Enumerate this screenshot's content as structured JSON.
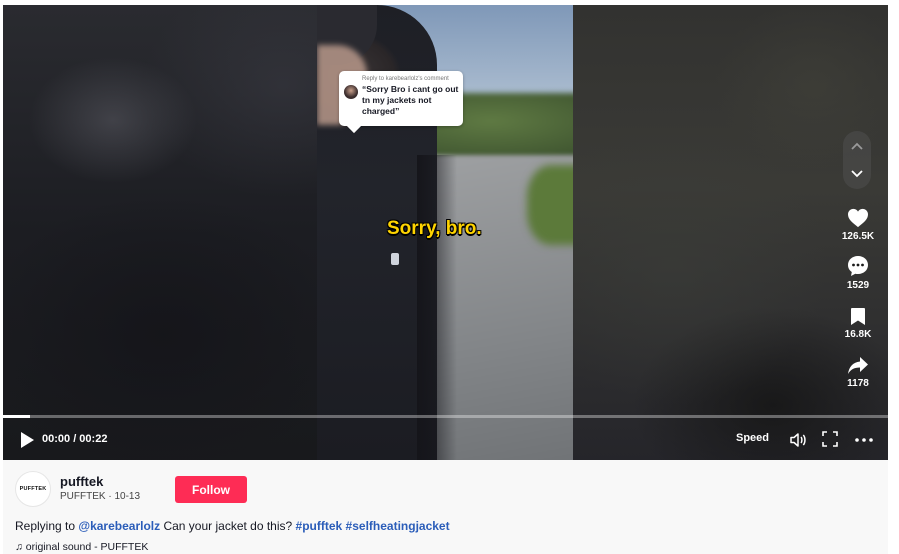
{
  "video": {
    "reply_header": "Reply to karebearlolz's comment",
    "comment_text": "“Sorry Bro i cant go out tn my jackets not charged”",
    "caption": "Sorry, bro.",
    "progress_fraction": 0.03
  },
  "actions": {
    "likes": "126.5K",
    "comments": "1529",
    "saves": "16.8K",
    "shares": "1178"
  },
  "controls": {
    "time": "00:00 / 00:22",
    "speed_label": "Speed"
  },
  "author": {
    "avatar_text": "PUFFTEK",
    "username": "pufftek",
    "display_name": "PUFFTEK",
    "separator": " · ",
    "date": "10-13",
    "follow_label": "Follow"
  },
  "description": {
    "prefix": "Replying to ",
    "mention": "@karebearlolz",
    "text": " Can your jacket do this? ",
    "hashtag1": "#pufftek",
    "hashtag2": "#selfheatingjacket"
  },
  "sound": {
    "icon": "♫",
    "label": "original sound - PUFFTEK"
  },
  "colors": {
    "follow": "#fe2c55",
    "link": "#2b5db9",
    "caption": "#ffd400"
  }
}
